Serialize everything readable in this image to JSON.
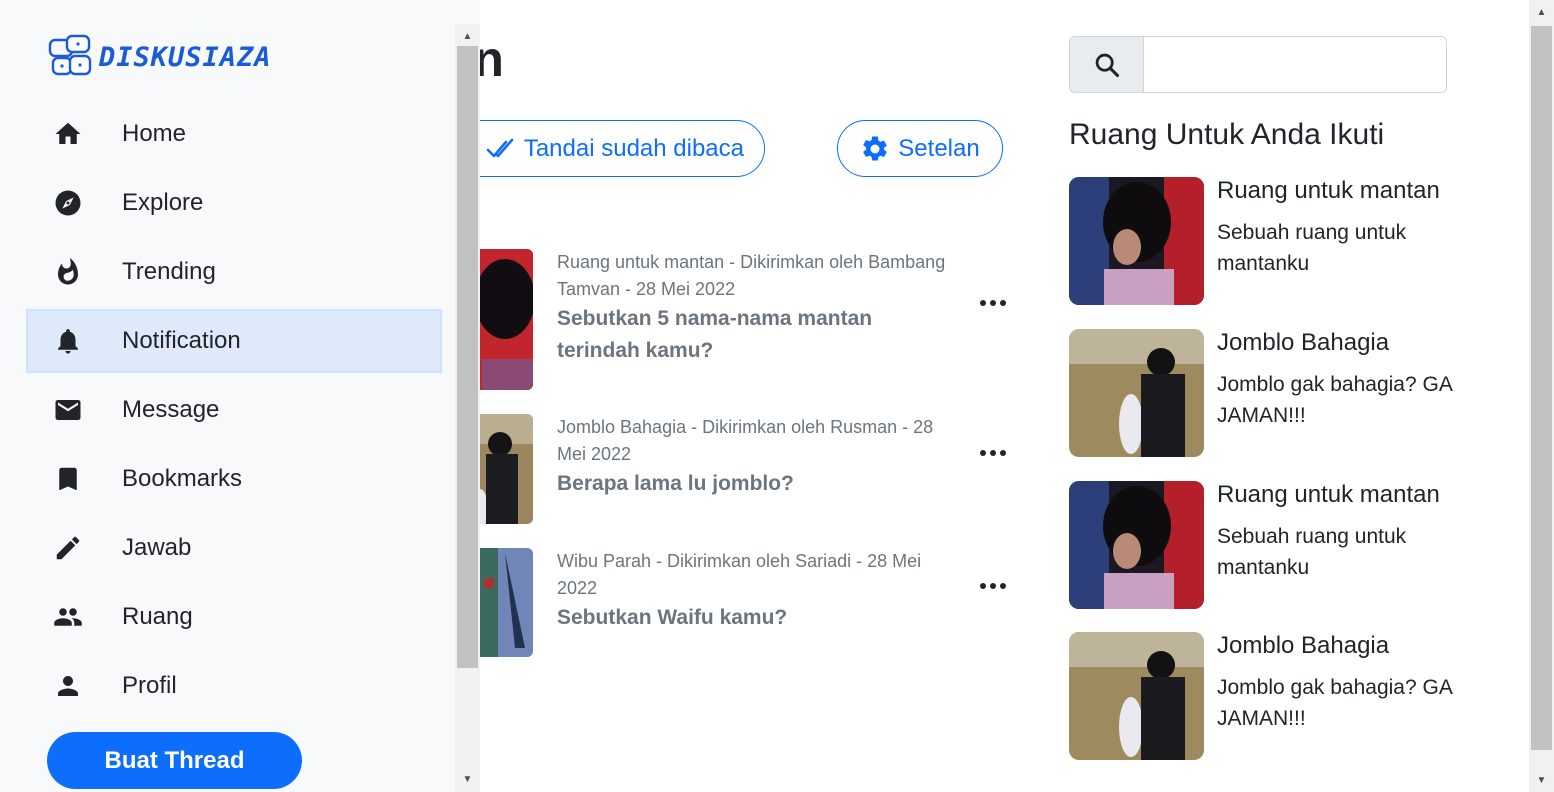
{
  "app": {
    "logo_text": "DISKUSIAZA"
  },
  "sidebar": {
    "items": [
      {
        "label": "Home",
        "icon": "home-icon"
      },
      {
        "label": "Explore",
        "icon": "compass-icon"
      },
      {
        "label": "Trending",
        "icon": "fire-icon"
      },
      {
        "label": "Notification",
        "icon": "bell-icon",
        "active": true
      },
      {
        "label": "Message",
        "icon": "mail-icon"
      },
      {
        "label": "Bookmarks",
        "icon": "bookmark-icon"
      },
      {
        "label": "Jawab",
        "icon": "pencil-icon"
      },
      {
        "label": "Ruang",
        "icon": "group-icon"
      },
      {
        "label": "Profil",
        "icon": "person-icon"
      }
    ],
    "create_button": "Buat Thread"
  },
  "main": {
    "title": "otification",
    "mark_read_button": "Tandai sudah dibaca",
    "settings_button": "Setelan",
    "notifications": [
      {
        "meta": "Ruang untuk mantan - Dikirimkan oleh Bambang Tamvan - 28 Mei 2022",
        "title": "Sebutkan 5 nama-nama mantan terindah kamu?"
      },
      {
        "meta": "Jomblo Bahagia - Dikirimkan oleh Rusman - 28 Mei 2022",
        "title": "Berapa lama lu jomblo?"
      },
      {
        "meta": "Wibu Parah - Dikirimkan oleh Sariadi - 28 Mei 2022",
        "title": "Sebutkan Waifu kamu?"
      }
    ]
  },
  "right": {
    "search": {
      "value": "",
      "placeholder": ""
    },
    "section_title": "Ruang Untuk Anda Ikuti",
    "rooms": [
      {
        "name": "Ruang untuk mantan",
        "desc": "Sebuah ruang untuk mantanku"
      },
      {
        "name": "Jomblo Bahagia",
        "desc": "Jomblo gak bahagia? GA JAMAN!!!"
      },
      {
        "name": "Ruang untuk mantan",
        "desc": "Sebuah ruang untuk mantanku"
      },
      {
        "name": "Jomblo Bahagia",
        "desc": "Jomblo gak bahagia? GA JAMAN!!!"
      }
    ]
  },
  "colors": {
    "accent": "#0d6efd",
    "active_bg": "#deeafa",
    "muted": "#6c757d"
  }
}
